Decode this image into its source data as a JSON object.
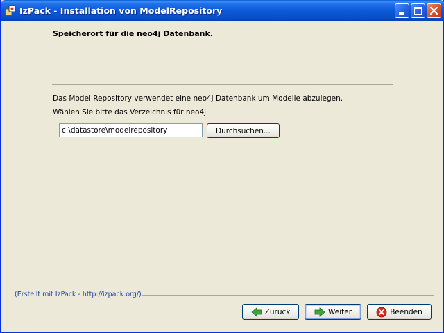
{
  "window": {
    "title": "IzPack - Installation von ModelRepository",
    "icon": "izpack-app-icon",
    "controls": [
      "minimize-icon",
      "maximize-icon",
      "close-icon"
    ]
  },
  "panel": {
    "heading": "Speicherort für die neo4j Datenbank.",
    "description_line1": "Das Model Repository verwendet eine neo4j Datenbank um Modelle abzulegen.",
    "description_line2": "Wählen Sie bitte das Verzeichnis für neo4j",
    "path_value": "c:\\datastore\\modelrepository",
    "browse_label": "Durchsuchen..."
  },
  "footer": {
    "credits": "(Erstellt mit IzPack - http://izpack.org/)",
    "back_label": "Zurück",
    "next_label": "Weiter",
    "quit_label": "Beenden"
  },
  "colors": {
    "titlebar": "#0b58d6",
    "background": "#ece9d8",
    "credits_text": "#1f3fa8",
    "arrow_green": "#3aa53a",
    "quit_red": "#d42a1a"
  }
}
